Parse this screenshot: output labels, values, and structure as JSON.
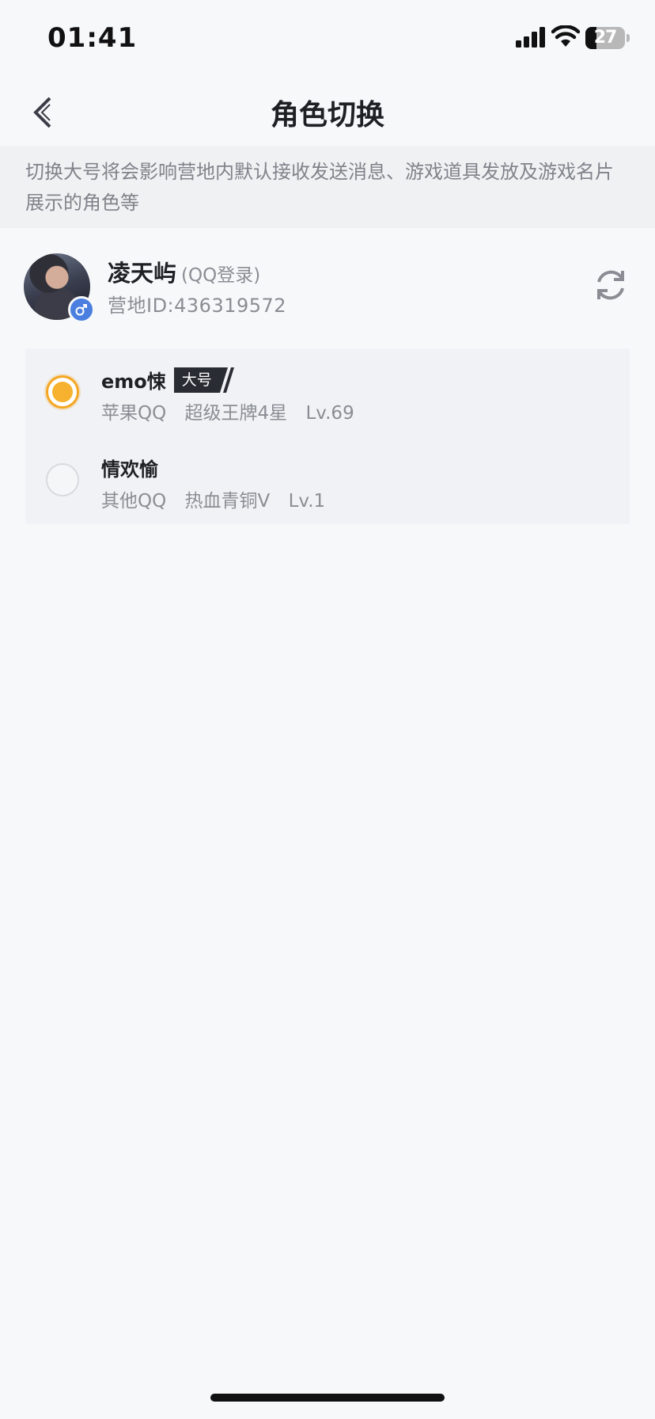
{
  "status_bar": {
    "time": "01:41",
    "battery_text": "27",
    "battery_level": 0.27,
    "icons": [
      "cellular-signal-icon",
      "wifi-icon",
      "battery-icon"
    ]
  },
  "nav": {
    "title": "角色切换",
    "back_icon": "chevron-left-icon"
  },
  "notice": {
    "text": "切换大号将会影响营地内默认接收发送消息、游戏道具发放及游戏名片展示的角色等"
  },
  "profile": {
    "name": "凌天屿",
    "login_type": "(QQ登录)",
    "camp_id": "营地ID:436319572",
    "gender_icon": "male-icon",
    "refresh_icon": "refresh-icon"
  },
  "roles": [
    {
      "name": "emo悚",
      "tag": "大号",
      "platform": "苹果QQ",
      "rank": "超级王牌4星",
      "level": "Lv.69",
      "selected": true
    },
    {
      "name": "情欢愉",
      "tag": "",
      "platform": "其他QQ",
      "rank": "热血青铜V",
      "level": "Lv.1",
      "selected": false
    }
  ],
  "colors": {
    "accent": "#f5a623",
    "background": "#f7f8fa",
    "notice_background": "#f0f1f3",
    "tag_background": "#2a2c33",
    "gender_badge": "#4a7fe0"
  }
}
